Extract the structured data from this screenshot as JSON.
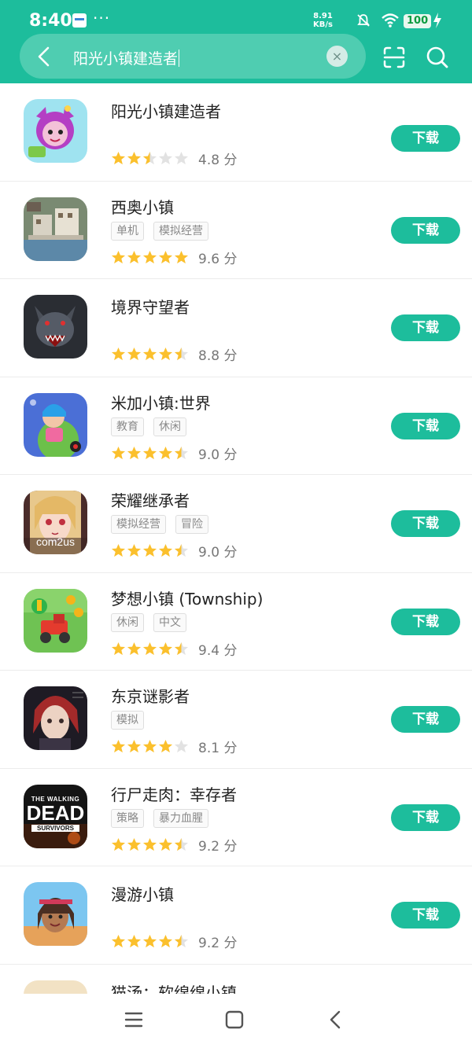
{
  "status_bar": {
    "time": "8:40",
    "more": "···",
    "net_speed_value": "8.91",
    "net_speed_unit": "KB/s",
    "battery": "100"
  },
  "search": {
    "query": "阳光小镇建造者",
    "clear_symbol": "×"
  },
  "download_label": "下载",
  "score_unit": "分",
  "colors": {
    "accent": "#1dbd9c",
    "star": "#fbc02d",
    "star_empty": "#e2e2e2"
  },
  "apps": [
    {
      "name": "阳光小镇建造者",
      "tags": [],
      "rating": 2.5,
      "score": "4.8",
      "icon": "cartoon-girl-app-icon"
    },
    {
      "name": "西奥小镇",
      "tags": [
        "单机",
        "模拟经营"
      ],
      "rating": 5,
      "score": "9.6",
      "icon": "city-builder-app-icon"
    },
    {
      "name": "境界守望者",
      "tags": [],
      "rating": 4.5,
      "score": "8.8",
      "icon": "werewolf-app-icon"
    },
    {
      "name": "米加小镇:世界",
      "tags": [
        "教育",
        "休闲"
      ],
      "rating": 4.5,
      "score": "9.0",
      "icon": "toca-world-app-icon"
    },
    {
      "name": "荣耀继承者",
      "tags": [
        "模拟经营",
        "冒险"
      ],
      "rating": 4.5,
      "score": "9.0",
      "icon": "anime-heroine-app-icon",
      "icon_text": "com2us"
    },
    {
      "name": "梦想小镇 (Township)",
      "tags": [
        "休闲",
        "中文"
      ],
      "rating": 4.5,
      "score": "9.4",
      "icon": "tractor-farm-app-icon"
    },
    {
      "name": "东京谜影者",
      "tags": [
        "模拟"
      ],
      "rating": 4,
      "score": "8.1",
      "icon": "red-hair-character-app-icon"
    },
    {
      "name": "行尸走肉：幸存者",
      "tags": [
        "策略",
        "暴力血腥"
      ],
      "rating": 4.5,
      "score": "9.2",
      "icon": "walking-dead-app-icon",
      "icon_text": "THE WALKING",
      "icon_text2": "DEAD",
      "icon_text3": "SURVIVORS"
    },
    {
      "name": "漫游小镇",
      "tags": [],
      "rating": 4.5,
      "score": "9.2",
      "icon": "smiling-girl-app-icon"
    },
    {
      "name": "猫汤：软绵绵小镇",
      "tags": [],
      "rating": 0,
      "score": "",
      "icon": "cat-soup-app-icon"
    }
  ]
}
